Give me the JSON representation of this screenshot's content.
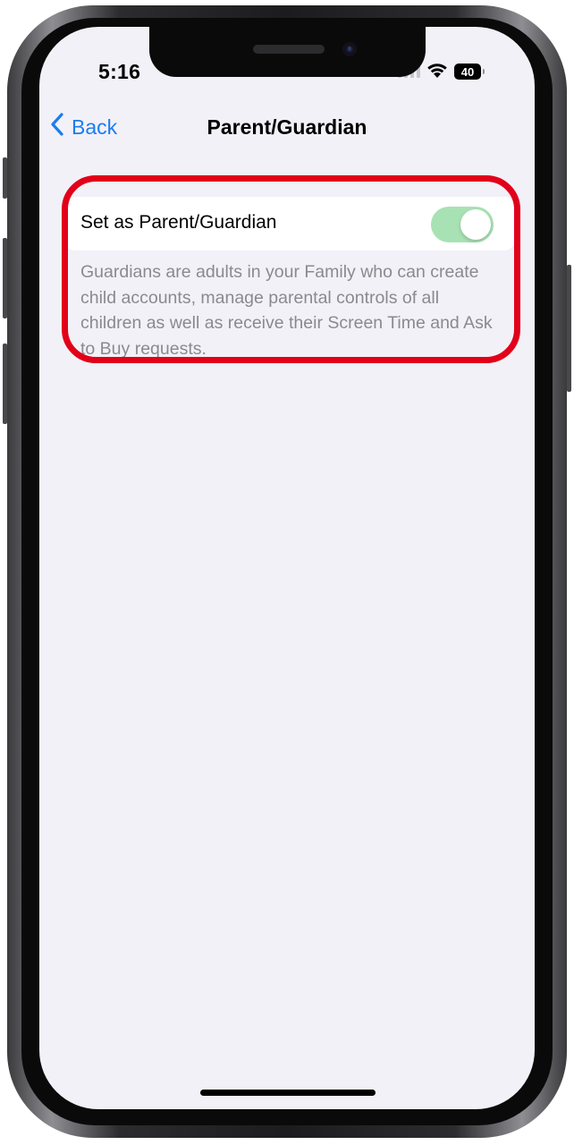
{
  "status_bar": {
    "time": "5:16",
    "battery_level": "40",
    "signal_icon": "cellular-signal-icon",
    "wifi_icon": "wifi-icon"
  },
  "nav": {
    "back_label": "Back",
    "title": "Parent/Guardian"
  },
  "settings": {
    "toggle_label": "Set as Parent/Guardian",
    "toggle_on": true,
    "description": "Guardians are adults in your Family who can create child accounts, manage parental controls of all children as well as receive their Screen Time and Ask to Buy requests."
  },
  "colors": {
    "accent": "#1a7cf1",
    "toggle_on": "#a8e2b4",
    "highlight": "#e2001a",
    "background": "#f2f1f7"
  }
}
